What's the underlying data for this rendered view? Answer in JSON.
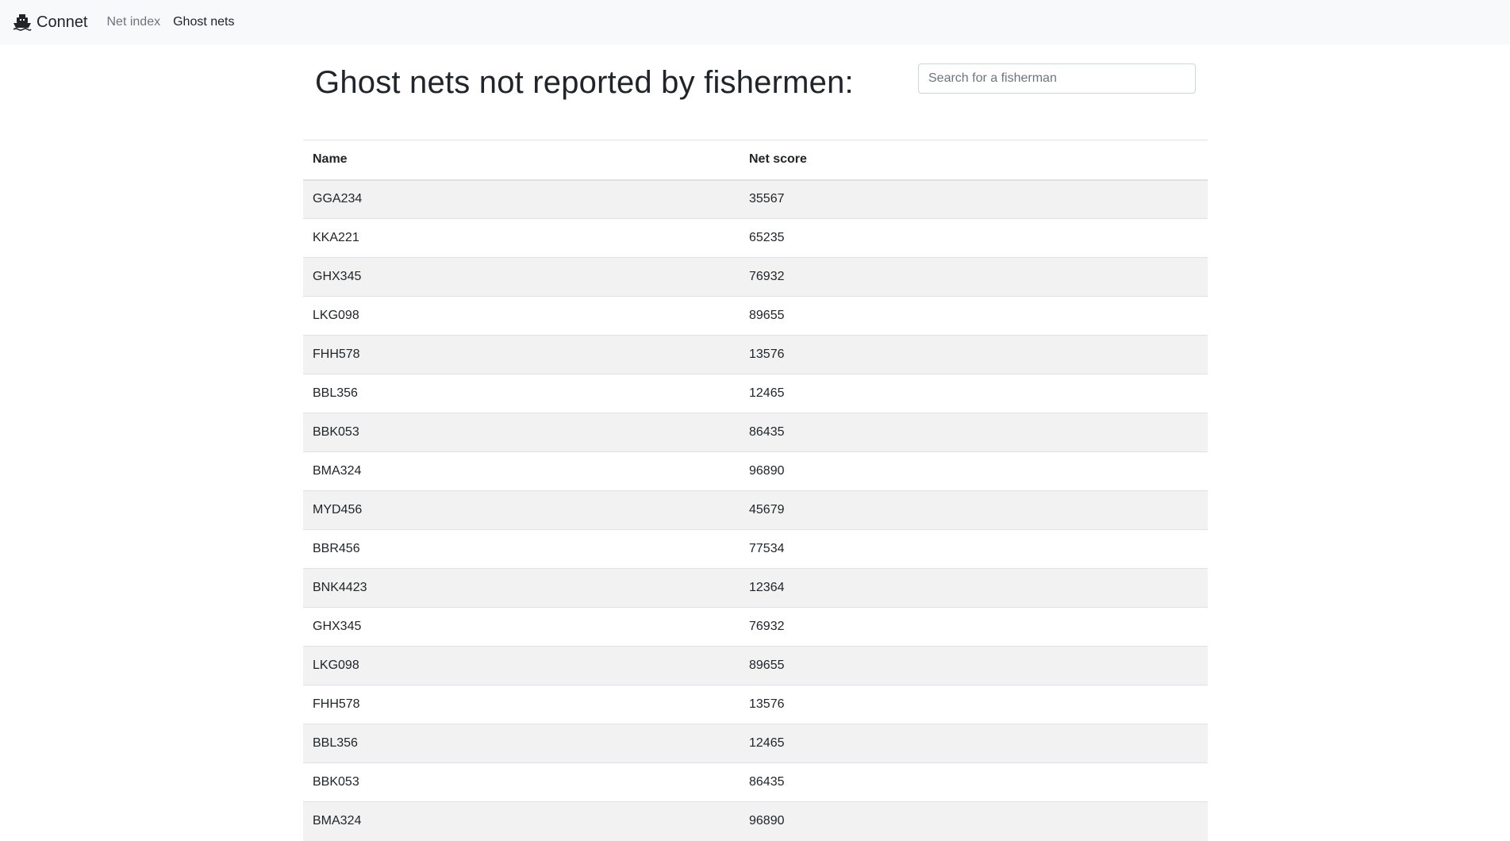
{
  "navbar": {
    "brand": "Connet",
    "links": [
      {
        "label": "Net index",
        "active": false
      },
      {
        "label": "Ghost nets",
        "active": true
      }
    ]
  },
  "page": {
    "title": "Ghost nets not reported by fishermen:"
  },
  "search": {
    "placeholder": "Search for a fisherman",
    "value": ""
  },
  "table": {
    "headers": [
      "Name",
      "Net score"
    ],
    "rows": [
      [
        "GGA234",
        "35567"
      ],
      [
        "KKA221",
        "65235"
      ],
      [
        "GHX345",
        "76932"
      ],
      [
        "LKG098",
        "89655"
      ],
      [
        "FHH578",
        "13576"
      ],
      [
        "BBL356",
        "12465"
      ],
      [
        "BBK053",
        "86435"
      ],
      [
        "BMA324",
        "96890"
      ],
      [
        "MYD456",
        "45679"
      ],
      [
        "BBR456",
        "77534"
      ],
      [
        "BNK4423",
        "12364"
      ],
      [
        "GHX345",
        "76932"
      ],
      [
        "LKG098",
        "89655"
      ],
      [
        "FHH578",
        "13576"
      ],
      [
        "BBL356",
        "12465"
      ],
      [
        "BBK053",
        "86435"
      ],
      [
        "BMA324",
        "96890"
      ]
    ]
  },
  "colors": {
    "navbar_bg": "#f8f9fa",
    "stripe": "#f2f2f2",
    "border": "#dee2e6"
  }
}
